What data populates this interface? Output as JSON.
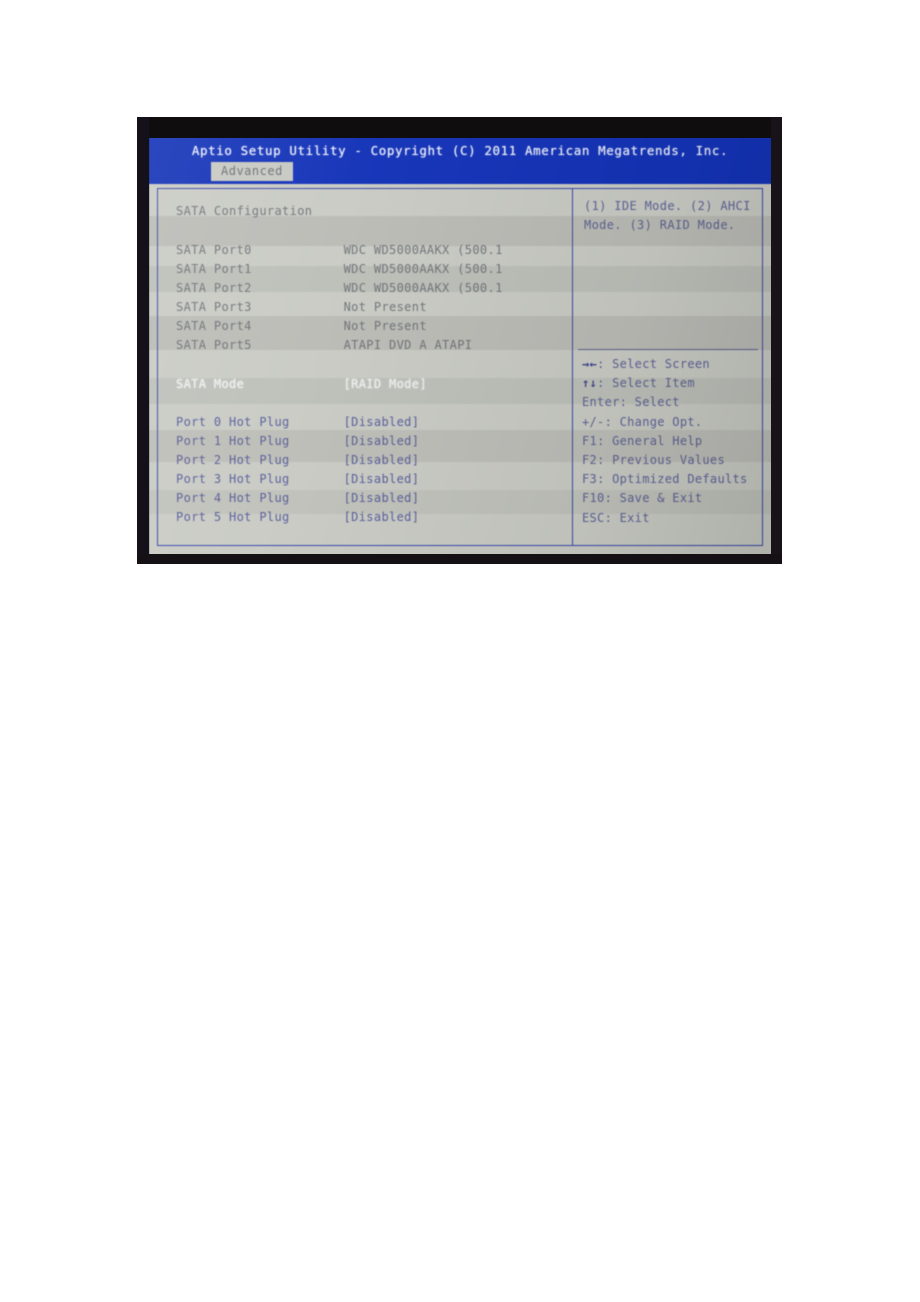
{
  "bios": {
    "title": "Aptio Setup Utility - Copyright (C) 2011 American Megatrends, Inc.",
    "active_tab": "Advanced",
    "section_header": "SATA Configuration",
    "ports": [
      {
        "label": "SATA Port0",
        "value": "WDC WD5000AAKX (500.1"
      },
      {
        "label": "SATA Port1",
        "value": "WDC WD5000AAKX (500.1"
      },
      {
        "label": "SATA Port2",
        "value": "WDC WD5000AAKX (500.1"
      },
      {
        "label": "SATA Port3",
        "value": "Not Present"
      },
      {
        "label": "SATA Port4",
        "value": "Not Present"
      },
      {
        "label": "SATA Port5",
        "value": "ATAPI   DVD A   ATAPI"
      }
    ],
    "sata_mode": {
      "label": "SATA Mode",
      "value": "[RAID Mode]"
    },
    "hot_plug": [
      {
        "label": "Port 0 Hot Plug",
        "value": "[Disabled]"
      },
      {
        "label": "Port 1 Hot Plug",
        "value": "[Disabled]"
      },
      {
        "label": "Port 2 Hot Plug",
        "value": "[Disabled]"
      },
      {
        "label": "Port 3 Hot Plug",
        "value": "[Disabled]"
      },
      {
        "label": "Port 4 Hot Plug",
        "value": "[Disabled]"
      },
      {
        "label": "Port 5 Hot Plug",
        "value": "[Disabled]"
      }
    ],
    "help_text": "(1) IDE Mode. (2) AHCI Mode. (3) RAID Mode.",
    "keys": [
      {
        "glyph": "→←",
        "text": ": Select Screen"
      },
      {
        "glyph": "↑↓",
        "text": ": Select Item"
      },
      {
        "glyph": "Enter",
        "text": ": Select"
      },
      {
        "glyph": "+/-",
        "text": ": Change Opt."
      },
      {
        "glyph": "F1",
        "text": ": General Help"
      },
      {
        "glyph": "F2",
        "text": ": Previous Values"
      },
      {
        "glyph": "F3",
        "text": ": Optimized Defaults"
      },
      {
        "glyph": "F10",
        "text": ": Save & Exit"
      },
      {
        "glyph": "ESC",
        "text": ": Exit"
      }
    ],
    "colors": {
      "titlebar_blue": "#1433b8",
      "screen_gray": "#c9cbc4",
      "frame_blue": "#3a49a8",
      "label_gray": "#73767c",
      "hotplug_blue": "#5a5f9c",
      "selected_white": "#ffffff"
    }
  }
}
